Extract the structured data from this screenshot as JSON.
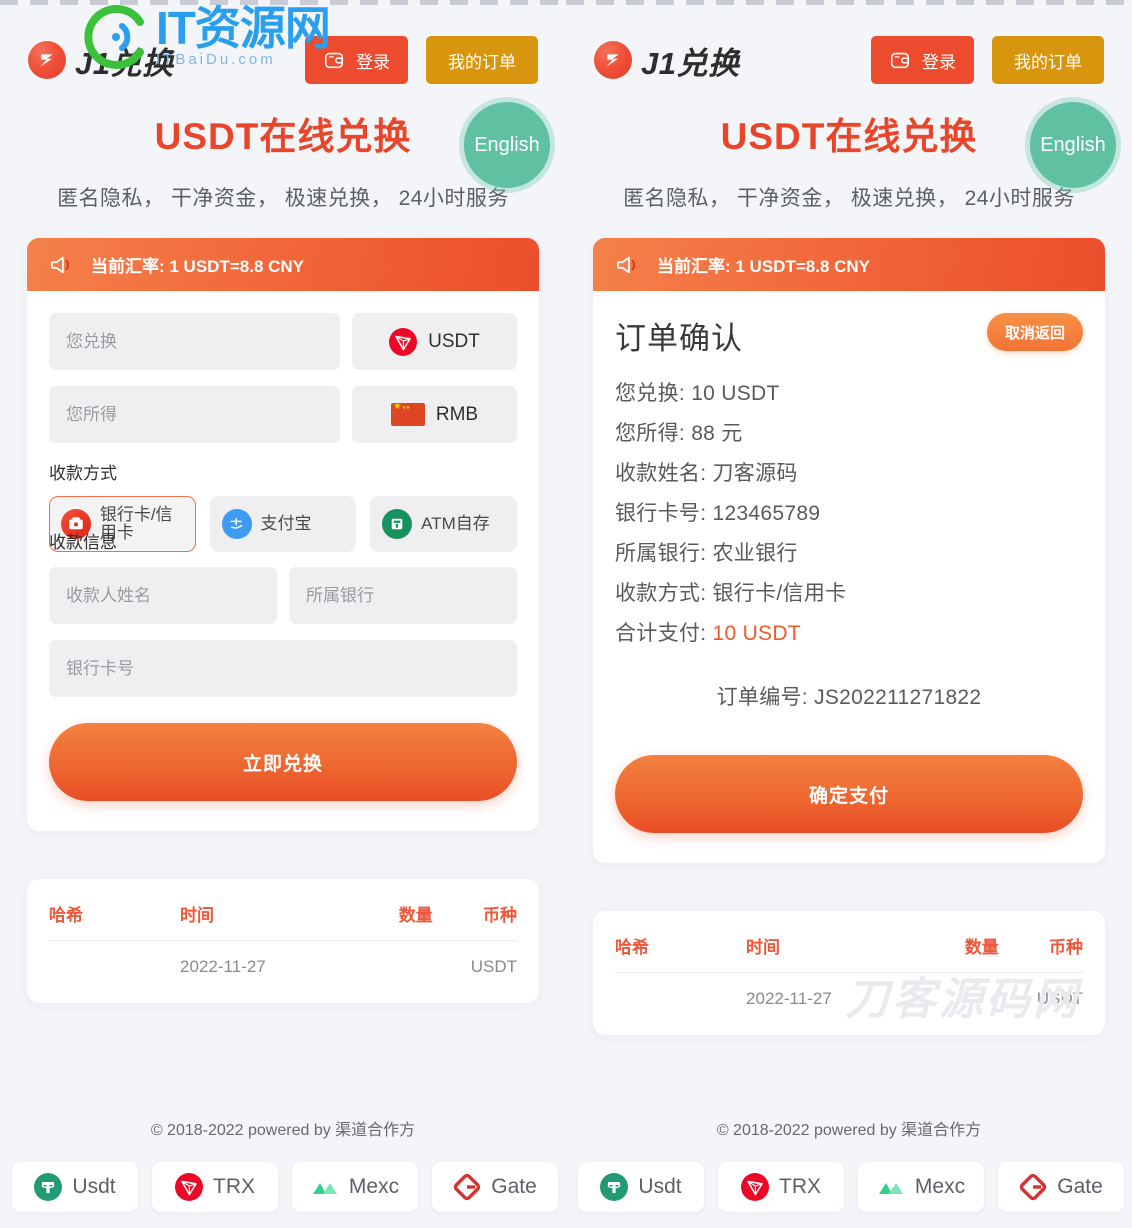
{
  "header": {
    "brand_text": "J1兑换",
    "brand_icon": "j1-logo-icon",
    "login_label": "登录",
    "login_icon": "wallet-icon",
    "orders_label": "我的订单"
  },
  "hero": {
    "title": "USDT在线兑换",
    "subtitle": "匿名隐私， 干净资金， 极速兑换， 24小时服务",
    "english_badge": "English"
  },
  "rate_bar": {
    "icon": "megaphone-icon",
    "text": "当前汇率: 1 USDT=8.8 CNY"
  },
  "exchange_form": {
    "pay_placeholder": "您兑换",
    "pay_currency": "USDT",
    "pay_currency_icon": "tron-icon",
    "receive_placeholder": "您所得",
    "receive_currency": "RMB",
    "receive_currency_icon": "cn-flag-icon",
    "method_label": "收款方式",
    "methods": [
      {
        "label": "银行卡/信用卡",
        "icon": "bank-card-icon",
        "active": true
      },
      {
        "label": "支付宝",
        "icon": "alipay-icon",
        "active": false
      },
      {
        "label": "ATM自存",
        "icon": "atm-icon",
        "active": false
      }
    ],
    "info_label": "收款信息",
    "name_placeholder": "收款人姓名",
    "bank_placeholder": "所属银行",
    "card_placeholder": "银行卡号",
    "submit_label": "立即兑换"
  },
  "order_confirm": {
    "title": "订单确认",
    "cancel_label": "取消返回",
    "lines": [
      {
        "label": "您兑换:",
        "value": "10 USDT",
        "highlight": false
      },
      {
        "label": "您所得:",
        "value": "88 元",
        "highlight": false
      },
      {
        "label": "收款姓名:",
        "value": "刀客源码",
        "highlight": false
      },
      {
        "label": "银行卡号:",
        "value": "123465789",
        "highlight": false
      },
      {
        "label": "所属银行:",
        "value": "农业银行",
        "highlight": false
      },
      {
        "label": "收款方式:",
        "value": "银行卡/信用卡",
        "highlight": false
      },
      {
        "label": "合计支付:",
        "value": "10 USDT",
        "highlight": true
      }
    ],
    "order_no_label": "订单编号:",
    "order_no": "JS202211271822",
    "confirm_label": "确定支付"
  },
  "tx_table": {
    "columns": [
      "哈希",
      "时间",
      "数量",
      "币种"
    ],
    "rows": [
      {
        "hash": "",
        "time": "2022-11-27",
        "amount": "",
        "coin": "USDT"
      }
    ]
  },
  "footer": {
    "copyright": "© 2018-2022 powered by 渠道合作方",
    "partners": [
      {
        "label": "Usdt",
        "icon": "usdt-icon"
      },
      {
        "label": "TRX",
        "icon": "trx-icon"
      },
      {
        "label": "Mexc",
        "icon": "mexc-icon"
      },
      {
        "label": "Gate",
        "icon": "gate-icon"
      }
    ]
  },
  "watermarks": {
    "daoke": "刀客源码网",
    "itziyuan": "IT资源网",
    "itziyuan_domain": "ITBaiDu.com"
  },
  "colors": {
    "brand_orange": "#ee4f37",
    "accent_orange": "#ed4b2e",
    "gold": "#d8960e",
    "teal": "#5fc0a2",
    "title_red": "#e8452a",
    "page_bg": "#f4f5f9"
  }
}
